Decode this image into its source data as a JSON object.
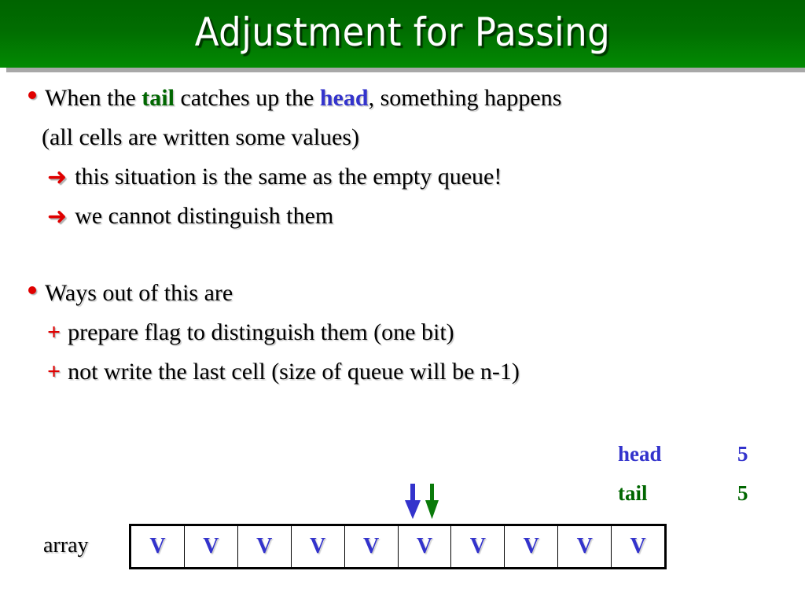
{
  "slide": {
    "title": "Adjustment for Passing",
    "title_bg_color": "#006400",
    "title_text_color": "#ffffff"
  },
  "colors": {
    "bullet_red": "#e00000",
    "head_blue": "#3333cc",
    "tail_green": "#006600",
    "body_black": "#000000"
  },
  "body": {
    "lines": [
      {
        "bullet": "dot-bullet",
        "indent": 0,
        "segments": [
          {
            "text": "When the ",
            "style": "plain"
          },
          {
            "text": "tail",
            "style": "tail"
          },
          {
            "text": " catches up the ",
            "style": "plain"
          },
          {
            "text": "head",
            "style": "head"
          },
          {
            "text": ", something happens",
            "style": "plain"
          }
        ]
      },
      {
        "bullet": "none",
        "indent": 1,
        "segments": [
          {
            "text": "(all cells are written some values)",
            "style": "plain"
          }
        ]
      },
      {
        "bullet": "arrow-bullet",
        "indent": 2,
        "segments": [
          {
            "text": "this situation is the same as the empty queue!",
            "style": "plain"
          }
        ]
      },
      {
        "bullet": "arrow-bullet",
        "indent": 2,
        "segments": [
          {
            "text": "we cannot distinguish them",
            "style": "plain"
          }
        ]
      },
      {
        "bullet": "none",
        "indent": 0,
        "blank": true,
        "segments": []
      },
      {
        "bullet": "dot-bullet",
        "indent": 0,
        "segments": [
          {
            "text": "Ways out of this are",
            "style": "plain"
          }
        ]
      },
      {
        "bullet": "plus-bullet",
        "indent": 2,
        "segments": [
          {
            "text": "prepare flag to distinguish them (one bit)",
            "style": "plain"
          }
        ]
      },
      {
        "bullet": "plus-bullet",
        "indent": 2,
        "segments": [
          {
            "text": "not write the last cell (size of queue will be n-1)",
            "style": "plain"
          }
        ]
      }
    ],
    "bullet_glyphs": {
      "arrow-bullet": "➜",
      "plus-bullet": "+"
    }
  },
  "diagram": {
    "array_label": "array",
    "cell_value": "V",
    "cell_count": 10,
    "cells": [
      "V",
      "V",
      "V",
      "V",
      "V",
      "V",
      "V",
      "V",
      "V",
      "V"
    ],
    "pointers": [
      {
        "name": "head",
        "label": "head",
        "value": "5",
        "color": "#3333cc",
        "index": 5
      },
      {
        "name": "tail",
        "label": "tail",
        "value": "5",
        "color": "#006600",
        "index": 5
      }
    ]
  }
}
